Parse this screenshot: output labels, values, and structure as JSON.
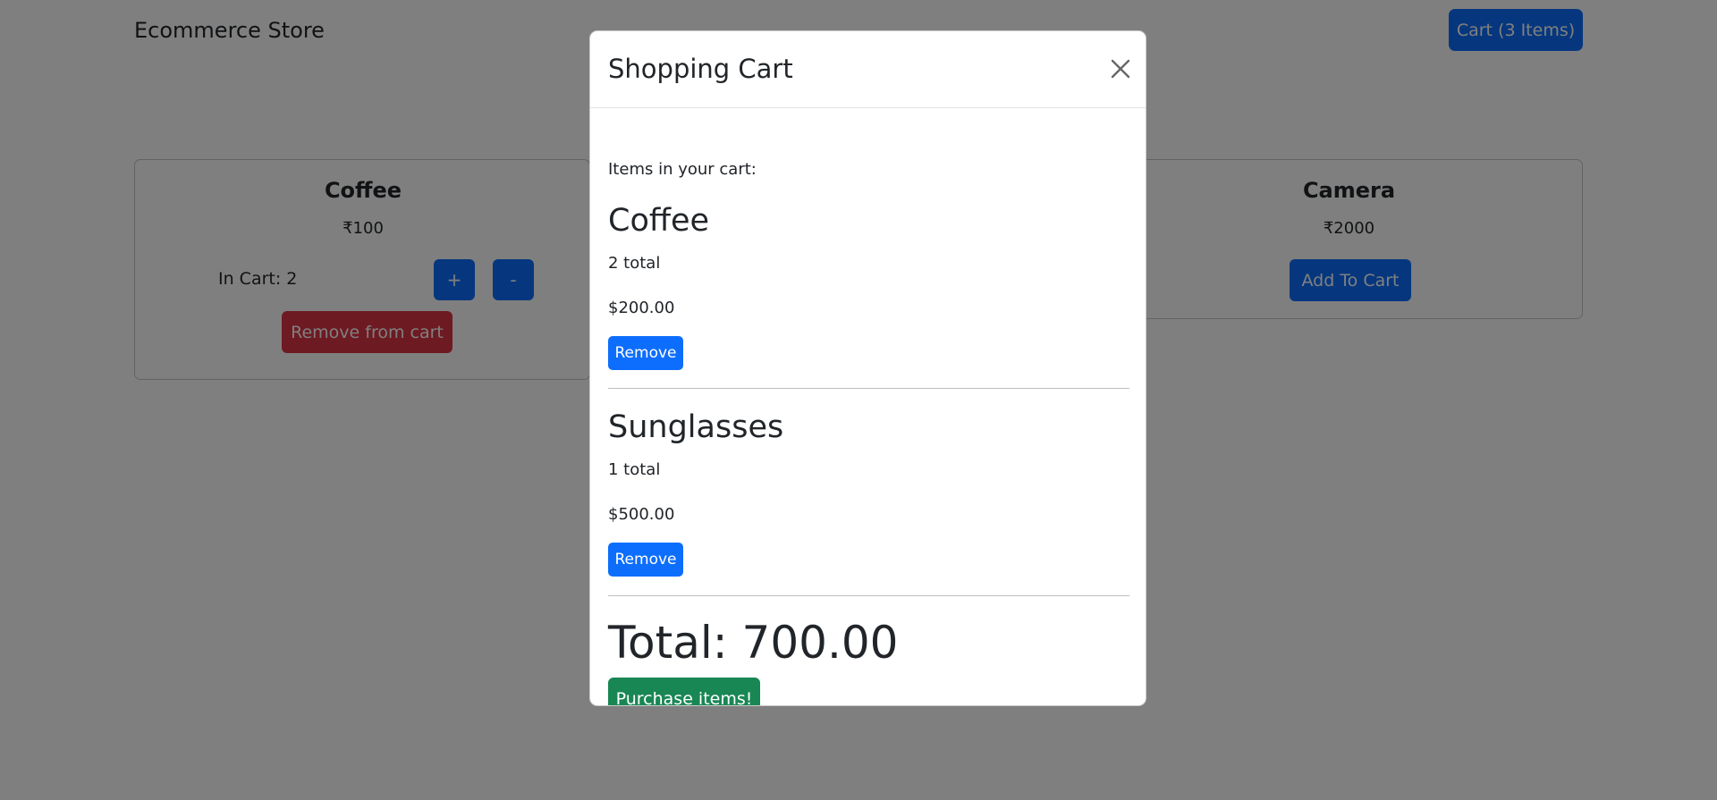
{
  "navbar": {
    "brand": "Ecommerce Store",
    "cart_button_label": "Cart (3 Items)"
  },
  "products": [
    {
      "name": "Coffee",
      "price": "₹100",
      "in_cart_label": "In Cart: 2",
      "plus_label": "+",
      "minus_label": "-",
      "remove_label": "Remove from cart"
    },
    {
      "name": "Camera",
      "price": "₹2000",
      "add_label": "Add To Cart"
    }
  ],
  "modal": {
    "title": "Shopping Cart",
    "close_icon": "close-icon",
    "intro": "Items in your cart:",
    "items": [
      {
        "name": "Coffee",
        "quantity": "2 total",
        "price": "$200.00",
        "remove_label": "Remove"
      },
      {
        "name": "Sunglasses",
        "quantity": "1 total",
        "price": "$500.00",
        "remove_label": "Remove"
      }
    ],
    "total": "Total: 700.00",
    "purchase_label": "Purchase items!"
  },
  "colors": {
    "primary": "#0d6efd",
    "danger": "#dc3545",
    "success": "#198754",
    "backdrop": "rgba(0,0,0,0.5)"
  }
}
